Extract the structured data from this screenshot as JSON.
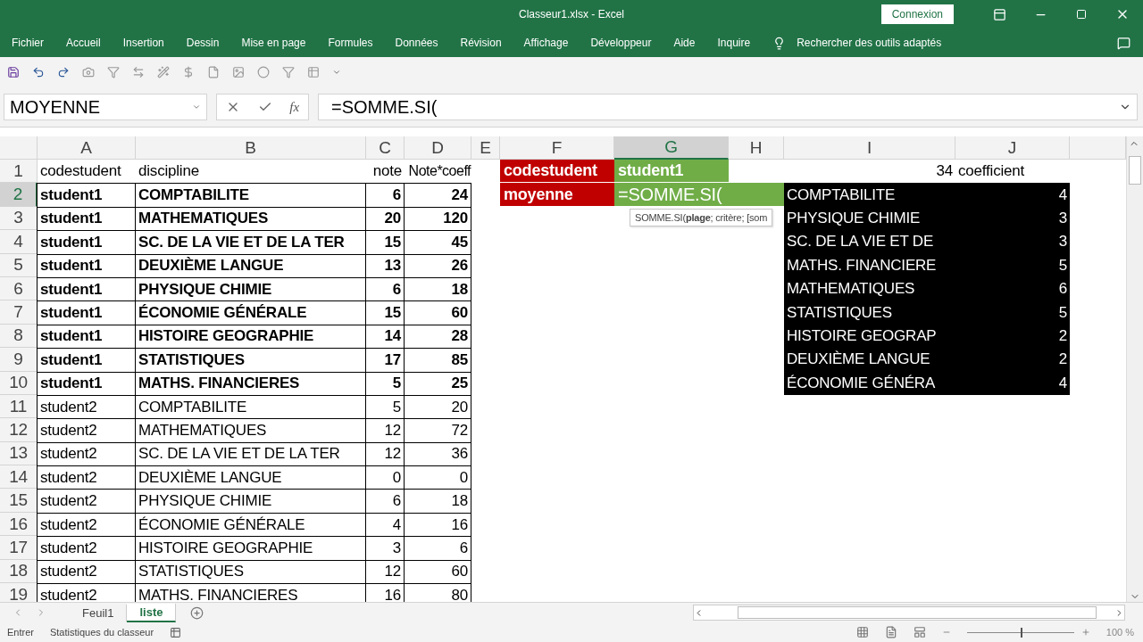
{
  "window": {
    "title": "Classeur1.xlsx  -  Excel",
    "account_button": "Connexion"
  },
  "menu": [
    "Fichier",
    "Accueil",
    "Insertion",
    "Dessin",
    "Mise en page",
    "Formules",
    "Données",
    "Révision",
    "Affichage",
    "Développeur",
    "Aide",
    "Inquire"
  ],
  "tell_me": "Rechercher des outils adaptés",
  "formula_bar": {
    "name_box": "MOYENNE",
    "fx": "fx",
    "formula": "=SOMME.SI("
  },
  "columns": [
    {
      "label": "A",
      "selected": false
    },
    {
      "label": "B",
      "selected": false
    },
    {
      "label": "C",
      "selected": false
    },
    {
      "label": "D",
      "selected": false
    },
    {
      "label": "E",
      "selected": false
    },
    {
      "label": "F",
      "selected": false
    },
    {
      "label": "G",
      "selected": true
    },
    {
      "label": "H",
      "selected": false
    },
    {
      "label": "I",
      "selected": false
    },
    {
      "label": "J",
      "selected": false
    }
  ],
  "rows": [
    {
      "number": "1",
      "selected": false,
      "kind": "header",
      "codestudent": "codestudent",
      "discipline": "discipline",
      "note": "note",
      "note_coeff": "Note*coeff"
    },
    {
      "number": "2",
      "selected": true,
      "kind": "bold",
      "codestudent": "student1",
      "discipline": "COMPTABILITE",
      "note": "6",
      "note_coeff": "24"
    },
    {
      "number": "3",
      "selected": false,
      "kind": "bold",
      "codestudent": "student1",
      "discipline": "MATHEMATIQUES",
      "note": "20",
      "note_coeff": "120"
    },
    {
      "number": "4",
      "selected": false,
      "kind": "bold",
      "codestudent": "student1",
      "discipline": "SC. DE LA VIE ET DE LA TER",
      "note": "15",
      "note_coeff": "45"
    },
    {
      "number": "5",
      "selected": false,
      "kind": "bold",
      "codestudent": "student1",
      "discipline": "DEUXIÈME LANGUE",
      "note": "13",
      "note_coeff": "26"
    },
    {
      "number": "6",
      "selected": false,
      "kind": "bold",
      "codestudent": "student1",
      "discipline": "PHYSIQUE CHIMIE",
      "note": "6",
      "note_coeff": "18"
    },
    {
      "number": "7",
      "selected": false,
      "kind": "bold",
      "codestudent": "student1",
      "discipline": "ÉCONOMIE GÉNÉRALE",
      "note": "15",
      "note_coeff": "60"
    },
    {
      "number": "8",
      "selected": false,
      "kind": "bold",
      "codestudent": "student1",
      "discipline": "HISTOIRE GEOGRAPHIE",
      "note": "14",
      "note_coeff": "28"
    },
    {
      "number": "9",
      "selected": false,
      "kind": "bold",
      "codestudent": "student1",
      "discipline": " STATISTIQUES",
      "note": "17",
      "note_coeff": "85"
    },
    {
      "number": "10",
      "selected": false,
      "kind": "bold",
      "codestudent": "student1",
      "discipline": "MATHS. FINANCIERES",
      "note": "5",
      "note_coeff": "25"
    },
    {
      "number": "11",
      "selected": false,
      "kind": "plain",
      "codestudent": "student2",
      "discipline": "COMPTABILITE",
      "note": "5",
      "note_coeff": "20"
    },
    {
      "number": "12",
      "selected": false,
      "kind": "plain",
      "codestudent": "student2",
      "discipline": "MATHEMATIQUES",
      "note": "12",
      "note_coeff": "72"
    },
    {
      "number": "13",
      "selected": false,
      "kind": "plain",
      "codestudent": "student2",
      "discipline": "SC. DE LA VIE ET DE LA TER",
      "note": "12",
      "note_coeff": "36"
    },
    {
      "number": "14",
      "selected": false,
      "kind": "plain",
      "codestudent": "student2",
      "discipline": "DEUXIÈME LANGUE",
      "note": "0",
      "note_coeff": "0"
    },
    {
      "number": "15",
      "selected": false,
      "kind": "plain",
      "codestudent": "student2",
      "discipline": "PHYSIQUE CHIMIE",
      "note": "6",
      "note_coeff": "18"
    },
    {
      "number": "16",
      "selected": false,
      "kind": "plain",
      "codestudent": "student2",
      "discipline": "ÉCONOMIE GÉNÉRALE",
      "note": "4",
      "note_coeff": "16"
    },
    {
      "number": "17",
      "selected": false,
      "kind": "plain",
      "codestudent": "student2",
      "discipline": "HISTOIRE GEOGRAPHIE",
      "note": "3",
      "note_coeff": "6"
    },
    {
      "number": "18",
      "selected": false,
      "kind": "plain",
      "codestudent": "student2",
      "discipline": " STATISTIQUES",
      "note": "12",
      "note_coeff": "60"
    },
    {
      "number": "19",
      "selected": false,
      "kind": "plain",
      "codestudent": "student2",
      "discipline": "MATHS. FINANCIERES",
      "note": "16",
      "note_coeff": "80"
    }
  ],
  "criteria": [
    {
      "label": "codestudent",
      "value": "student1",
      "editing": false
    },
    {
      "label": "moyenne",
      "value": "=SOMME.SI(",
      "editing": true
    }
  ],
  "tooltip": "SOMME.SI(**plage**; critère; [som",
  "coefficient_total": "34",
  "coefficient_heading": "coefficient",
  "coefficients": [
    {
      "discipline": "COMPTABILITE",
      "coeff": "4"
    },
    {
      "discipline": "PHYSIQUE CHIMIE",
      "coeff": "3"
    },
    {
      "discipline": "SC. DE LA VIE ET DE",
      "coeff": "3"
    },
    {
      "discipline": "MATHS. FINANCIERE",
      "coeff": "5"
    },
    {
      "discipline": "MATHEMATIQUES",
      "coeff": "6"
    },
    {
      "discipline": " STATISTIQUES",
      "coeff": "5"
    },
    {
      "discipline": "HISTOIRE GEOGRAP",
      "coeff": "2"
    },
    {
      "discipline": "DEUXIÈME LANGUE",
      "coeff": "2"
    },
    {
      "discipline": "ÉCONOMIE GÉNÉRA",
      "coeff": "4"
    }
  ],
  "sheet_tabs": [
    {
      "label": "Feuil1",
      "selected": false
    },
    {
      "label": "liste",
      "selected": true
    }
  ],
  "status": {
    "mode": "Entrer",
    "stats": "Statistiques du classeur",
    "zoom": "100 %",
    "level": 0.5
  }
}
